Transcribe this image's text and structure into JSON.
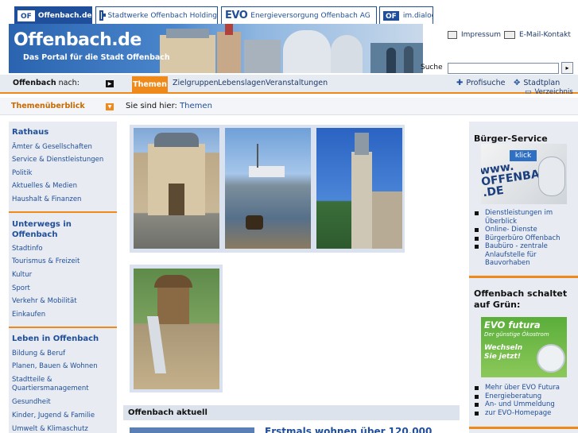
{
  "top_tabs": [
    {
      "logo": "OF",
      "label": "Offenbach.de"
    },
    {
      "label": "Stadtwerke Offenbach Holding"
    },
    {
      "logo": "EVO",
      "label": "Energieversorgung Offenbach AG"
    },
    {
      "logo": "OF",
      "label": "im.dialog"
    }
  ],
  "banner": {
    "title": "Offenbach.de",
    "subtitle": "Das Portal für die Stadt Offenbach"
  },
  "header": {
    "impressum": "Impressum",
    "kontakt": "E-Mail-Kontakt",
    "search_label": "Suche",
    "search_value": "",
    "search_button": "▸"
  },
  "nav": {
    "label_bold": "Offenbach",
    "label_rest": " nach:",
    "active_tab": "Themen",
    "items": [
      "Zielgruppen",
      "Lebenslagen",
      "Veranstaltungen"
    ],
    "profisuche": "Profisuche",
    "stadtplan": "Stadtplan",
    "verzeichnis": "Verzeichnis"
  },
  "crumbbar": {
    "overview": "Themenüberblick",
    "prefix": "Sie sind hier:",
    "current": "Themen"
  },
  "sidebar": {
    "sections": [
      {
        "title": "Rathaus",
        "items": [
          "Ämter & Gesellschaften",
          "Service & Dienstleistungen",
          "Politik",
          "Aktuelles & Medien",
          "Haushalt & Finanzen"
        ]
      },
      {
        "title": "Unterwegs in Offenbach",
        "items": [
          "Stadtinfo",
          "Tourismus & Freizeit",
          "Kultur",
          "Sport",
          "Verkehr & Mobilität",
          "Einkaufen"
        ]
      },
      {
        "title": "Leben in Offenbach",
        "items": [
          "Bildung & Beruf",
          "Planen, Bauen & Wohnen",
          "Stadtteile & Quartiersmanagement",
          "Gesundheit",
          "Kinder, Jugend & Familie",
          "Umwelt & Klimaschutz"
        ]
      }
    ]
  },
  "main": {
    "aktuell": "Offenbach aktuell",
    "news_title": "Erstmals wohnen über 120.000"
  },
  "rbar": {
    "buerger_title": "Bürger-Service",
    "buerger_image_text": "www. OFFENBACH .DE",
    "buerger_image_tag": "klick",
    "buerger_items": [
      "Dienstleistungen im Überblick",
      "Online- Dienste",
      "Bürgerbüro Offenbach",
      "Baubüro - zentrale Anlaufstelle für Bauvorhaben"
    ],
    "gruen_title": "Offenbach schaltet auf Grün:",
    "evo_brand": "EVO futura",
    "evo_tagline": "Der günstige Ökostrom",
    "evo_cta": "Wechseln Sie jetzt!",
    "gruen_items": [
      "Mehr über EVO Futura",
      "Energieberatung",
      "An- und Ummeldung",
      "zur EVO-Homepage"
    ]
  },
  "colors": {
    "brand_blue": "#1f4e9a",
    "accent_orange": "#ef8a1a",
    "sidebar_bg": "#e8ebf1"
  }
}
